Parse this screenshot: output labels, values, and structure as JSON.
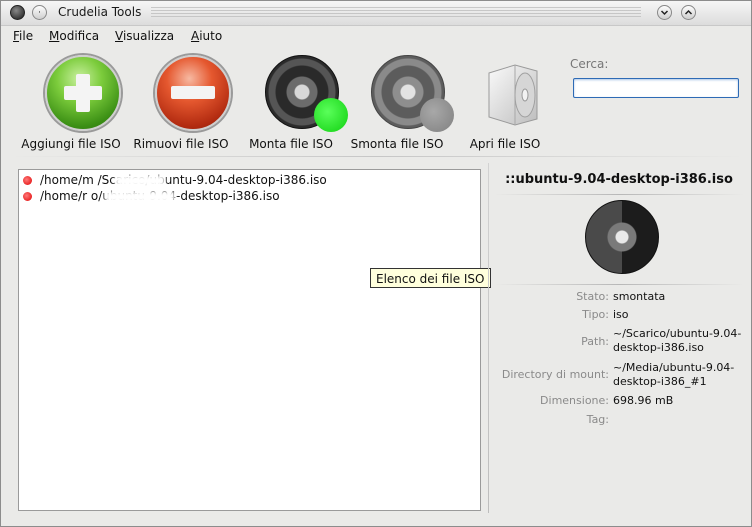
{
  "window": {
    "title": "Crudelia Tools"
  },
  "menu": {
    "items": [
      {
        "label": "File"
      },
      {
        "label": "Modifica"
      },
      {
        "label": "Visualizza"
      },
      {
        "label": "Aiuto"
      }
    ]
  },
  "toolbar": {
    "add_label": "Aggiungi file ISO",
    "remove_label": "Rimuovi file ISO",
    "mount_label": "Monta file ISO",
    "unmount_label": "Smonta file ISO",
    "open_label": "Apri file ISO"
  },
  "search": {
    "label": "Cerca:",
    "value": ""
  },
  "files": [
    {
      "path": "/home/m         /Scarico/ubuntu-9.04-desktop-i386.iso"
    },
    {
      "path": "/home/r                 o/ubuntu-9.04-desktop-i386.iso"
    }
  ],
  "tooltip": "Elenco dei file ISO",
  "details": {
    "title": "::ubuntu-9.04-desktop-i386.iso",
    "rows": [
      {
        "label": "Stato:",
        "value": "smontata"
      },
      {
        "label": "Tipo:",
        "value": "iso"
      },
      {
        "label": "Path:",
        "value": "~/Scarico/ubuntu-9.04-desktop-i386.iso"
      },
      {
        "label": "Directory di mount:",
        "value": "~/Media/ubuntu-9.04-desktop-i386_#1"
      },
      {
        "label": "Dimensione:",
        "value": "698.96 mB"
      },
      {
        "label": "Tag:",
        "value": ""
      }
    ]
  },
  "colors": {
    "mounted_indicator": "#10d010",
    "unmounted_indicator": "#808080",
    "list_bullet": "#e00000",
    "search_focus": "#2e6bb5"
  },
  "icons": [
    "window-menu-icon",
    "sticky-icon",
    "minimize-icon",
    "maximize-icon",
    "add-icon",
    "remove-icon",
    "mount-disc-icon",
    "unmount-disc-icon",
    "cd-case-icon",
    "iso-disc-icon"
  ]
}
